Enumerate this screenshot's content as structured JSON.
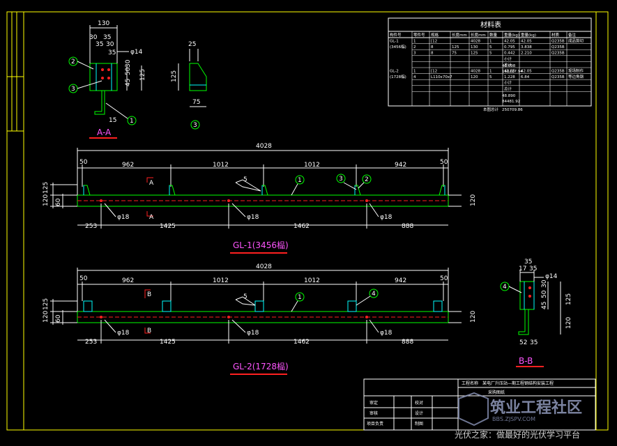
{
  "colors": {
    "background": "#000000",
    "frame": "#ffff00",
    "steel": "#00ff00",
    "dimension": "#ffffff",
    "label": "#ff55ff",
    "centerline": "#ff2020",
    "plate": "#00ffff"
  },
  "section_a": {
    "title": "A-A",
    "dims": [
      "130",
      "30",
      "35",
      "35",
      "30",
      "35",
      "45",
      "50",
      "30",
      "125",
      "15"
    ],
    "bolt": "φ14",
    "parts": [
      "2",
      "3",
      "1"
    ]
  },
  "part3": {
    "dims": [
      "25",
      "125",
      "75"
    ],
    "tag": "3"
  },
  "beam1": {
    "total": "4028",
    "top_dims": [
      "50",
      "962",
      "1012",
      "1012",
      "942",
      "50"
    ],
    "bottom_dims": [
      "253",
      "1425",
      "1462",
      "888"
    ],
    "holes": [
      "φ18",
      "φ18",
      "φ18"
    ],
    "left_dims": [
      "125",
      "120",
      "60"
    ],
    "right_dim": "120",
    "section_mark": "A",
    "weld": "5",
    "parts": [
      "1",
      "3",
      "2"
    ],
    "title": "GL-1(3456榀)"
  },
  "beam2": {
    "total": "4028",
    "top_dims": [
      "50",
      "962",
      "1012",
      "1012",
      "942",
      "50"
    ],
    "bottom_dims": [
      "253",
      "1425",
      "1462",
      "888"
    ],
    "holes": [
      "φ18",
      "φ18",
      "φ18"
    ],
    "left_dims": [
      "125",
      "120",
      "60"
    ],
    "right_dim": "120",
    "section_mark": "B",
    "weld": "5",
    "parts": [
      "1",
      "4"
    ],
    "title": "GL-2(1728榀)"
  },
  "section_b": {
    "title": "B-B",
    "dims": [
      "35",
      "17",
      "35",
      "45",
      "50",
      "30",
      "125",
      "120",
      "52",
      "35"
    ],
    "bolt": "φ14",
    "part": "4"
  },
  "material_table": {
    "title": "材料表",
    "headers": [
      "构件号",
      "零件号",
      "规格",
      "长度mm",
      "长度mm",
      "数量",
      "重量(kg)",
      "重量(kg)",
      "材质",
      "备注"
    ],
    "rows": [
      [
        "GL-1",
        "1",
        "[12",
        "",
        "4028",
        "1",
        "42.05",
        "42.05",
        "Q235B",
        "成品剪切"
      ],
      [
        "(3456榀)",
        "2",
        "8",
        "125",
        "130",
        "5",
        "0.795",
        "3.838",
        "Q235B",
        ""
      ],
      [
        "",
        "3",
        "8",
        "75",
        "125",
        "5",
        "0.442",
        "2.210",
        "Q235B",
        ""
      ],
      [
        "",
        "",
        "",
        "",
        "",
        "",
        "小计",
        "",
        "",
        ""
      ],
      [
        "",
        "",
        "",
        "",
        "",
        "",
        "总计",
        "",
        "",
        ""
      ],
      [
        "GL-2",
        "1",
        "[12",
        "",
        "4028",
        "1",
        "42.05",
        "42.05",
        "Q235B",
        "现场制作"
      ],
      [
        "(1728榀)",
        "4",
        "L110x70x7",
        "",
        "120",
        "5",
        "1.228",
        "6.84",
        "Q235B",
        "等边角钢"
      ],
      [
        "",
        "",
        "",
        "",
        "",
        "",
        "小计",
        "",
        "",
        ""
      ],
      [
        "",
        "",
        "",
        "",
        "",
        "",
        "总计",
        "",
        "",
        ""
      ]
    ],
    "subtotal1": "48.098",
    "total1": "166227.94",
    "subtotal2": "48.890",
    "total2": "84481.92",
    "grand_label": "本图总计",
    "grand_total": "250709.86"
  },
  "title_block": {
    "project_label": "工程名称",
    "project": "某电厂升压站—期工程钢结构安装工程",
    "row2": "采购图纸",
    "labels": [
      "审定",
      "审核",
      "项目负责",
      "校对",
      "设计",
      "制图"
    ]
  },
  "watermark": {
    "line1": "筑业工程社区",
    "line2": "BBS.ZJSPV.COM",
    "footer": "光伏之家：做最好的光伏学习平台"
  }
}
